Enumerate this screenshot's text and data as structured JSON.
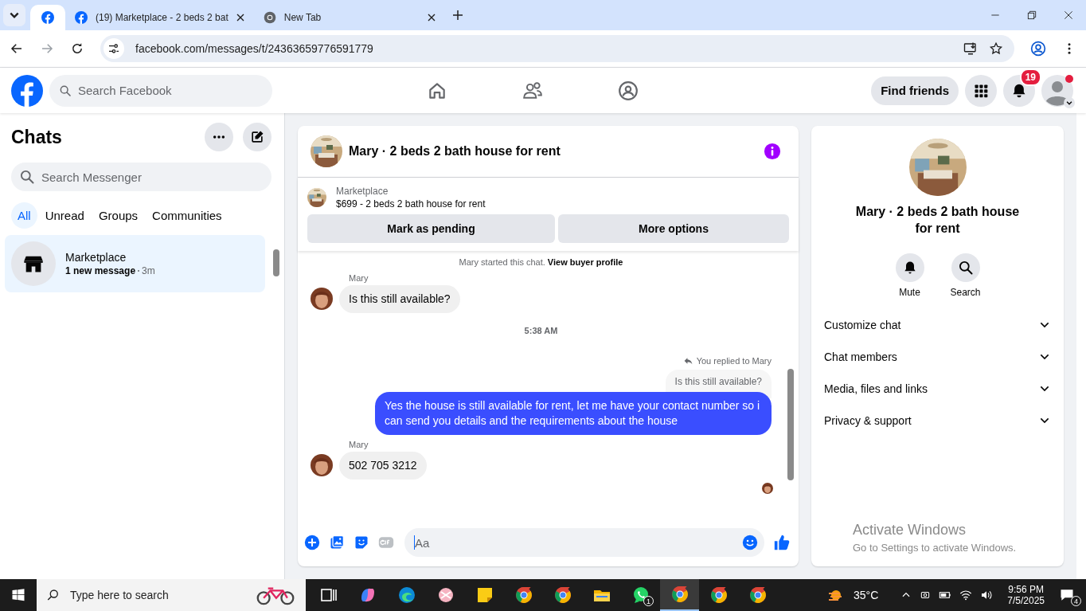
{
  "browser": {
    "tabs": [
      {
        "kind": "facebook",
        "selected": true
      },
      {
        "kind": "facebook",
        "title": "(19) Marketplace - 2 beds 2 bat",
        "selected": false
      },
      {
        "kind": "chrome",
        "title": "New Tab",
        "selected": false
      }
    ],
    "url": "facebook.com/messages/t/24363659776591779"
  },
  "header": {
    "search_placeholder": "Search Facebook",
    "find_friends": "Find friends",
    "notification_count": "19"
  },
  "sidebar": {
    "title": "Chats",
    "search_placeholder": "Search Messenger",
    "filters": [
      {
        "label": "All",
        "selected": true
      },
      {
        "label": "Unread",
        "selected": false
      },
      {
        "label": "Groups",
        "selected": false
      },
      {
        "label": "Communities",
        "selected": false
      }
    ],
    "conversations": [
      {
        "name": "Marketplace",
        "preview": "1 new message",
        "time": "3m",
        "selected": true,
        "unread": true
      }
    ]
  },
  "conversation": {
    "title": "Mary · 2 beds 2 bath house for rent",
    "listing": {
      "label": "Marketplace",
      "title": "$699 - 2 beds 2 bath house for rent"
    },
    "buttons": [
      "Mark as pending",
      "More options"
    ],
    "messages": [
      {
        "kind": "system",
        "text": "Mary started this chat.",
        "link": "View buyer profile"
      },
      {
        "kind": "incoming",
        "sender": "Mary",
        "text": "Is this still available?"
      },
      {
        "kind": "timestamp",
        "text": "5:38 AM"
      },
      {
        "kind": "reply",
        "context": "You replied to Mary",
        "quote": "Is this still available?"
      },
      {
        "kind": "outgoing",
        "text": "Yes the house is still available for rent, let me have your contact number so i can send you details and the requirements about the house"
      },
      {
        "kind": "incoming",
        "sender": "Mary",
        "text": "502 705 3212"
      },
      {
        "kind": "seen"
      }
    ],
    "composer_placeholder": "Aa"
  },
  "details": {
    "name": "Mary · 2 beds 2 bath house for rent",
    "actions": [
      {
        "kind": "mute",
        "label": "Mute"
      },
      {
        "kind": "search",
        "label": "Search"
      }
    ],
    "sections": [
      "Customize chat",
      "Chat members",
      "Media, files and links",
      "Privacy & support"
    ]
  },
  "activation": {
    "title": "Activate Windows",
    "subtitle": "Go to Settings to activate Windows."
  },
  "taskbar": {
    "search_placeholder": "Type here to search",
    "apps": [
      {
        "kind": "taskview",
        "active": false
      },
      {
        "kind": "copilot",
        "active": false
      },
      {
        "kind": "edge",
        "active": false
      },
      {
        "kind": "snip",
        "active": false
      },
      {
        "kind": "sticky",
        "active": false
      },
      {
        "kind": "chrome",
        "active": false
      },
      {
        "kind": "chrome",
        "active": false
      },
      {
        "kind": "files",
        "active": false
      },
      {
        "kind": "whatsapp",
        "active": false,
        "badge": "1"
      },
      {
        "kind": "chrome",
        "active": true
      },
      {
        "kind": "chrome",
        "active": false
      },
      {
        "kind": "chrome",
        "active": false
      }
    ],
    "temperature": "35°C",
    "time": "9:56 PM",
    "date": "7/5/2025",
    "notifications": "4"
  }
}
